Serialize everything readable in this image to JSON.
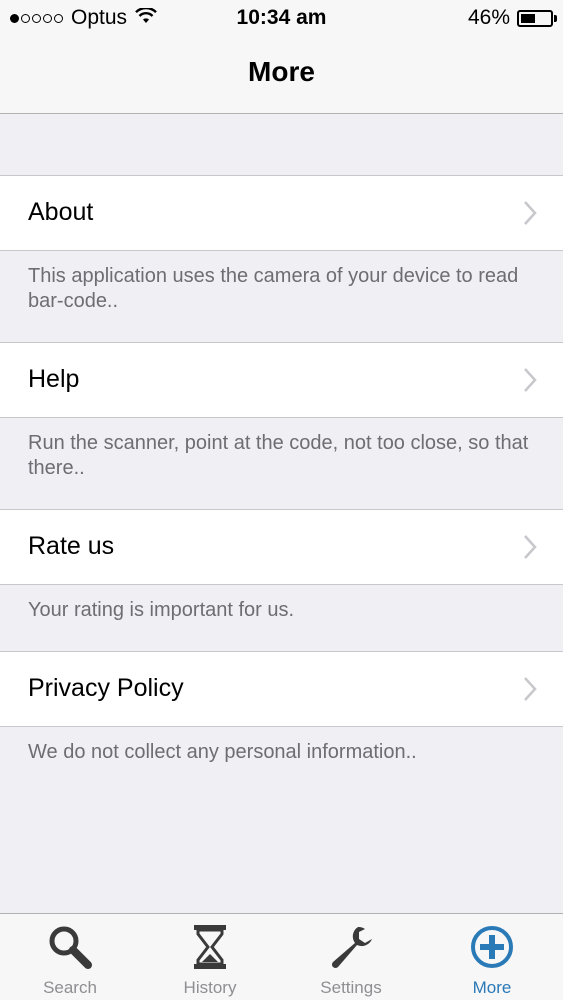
{
  "status_bar": {
    "carrier": "Optus",
    "time": "10:34 am",
    "battery": "46%"
  },
  "nav": {
    "title": "More"
  },
  "items": [
    {
      "label": "About",
      "description": "This application uses the camera of your device to read bar-code.."
    },
    {
      "label": "Help",
      "description": "Run the scanner, point at the code, not too close, so that there.."
    },
    {
      "label": "Rate us",
      "description": "Your rating is important for us."
    },
    {
      "label": "Privacy Policy",
      "description": "We do not collect any personal information.."
    }
  ],
  "tabs": [
    {
      "label": "Search",
      "icon": "search-icon"
    },
    {
      "label": "History",
      "icon": "hourglass-icon"
    },
    {
      "label": "Settings",
      "icon": "wrench-icon"
    },
    {
      "label": "More",
      "icon": "plus-circle-icon",
      "active": true
    }
  ],
  "colors": {
    "accent": "#2a7ab8",
    "background": "#efeff4",
    "secondary_text": "#6d6d72"
  }
}
